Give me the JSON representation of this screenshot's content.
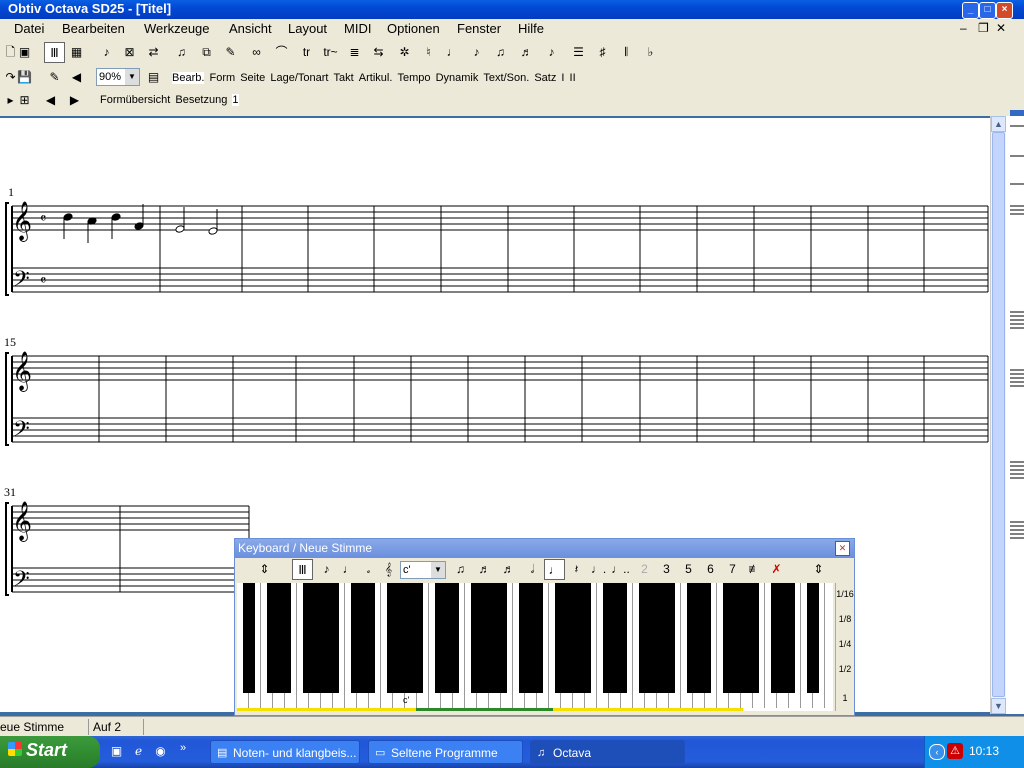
{
  "window": {
    "title": "Obtiv Octava SD25 - [Titel]"
  },
  "menu": [
    "Datei",
    "Bearbeiten",
    "Werkzeuge",
    "Ansicht",
    "Layout",
    "MIDI",
    "Optionen",
    "Fenster",
    "Hilfe"
  ],
  "toolbar": {
    "zoom": "90%",
    "tabs": [
      "Bearb.",
      "Form",
      "Seite",
      "Lage/Tonart",
      "Takt",
      "Artikul.",
      "Tempo",
      "Dynamik",
      "Text/Son.",
      "Satz",
      "I",
      "II"
    ],
    "tabs2": [
      "Formübersicht",
      "Besetzung",
      "1"
    ]
  },
  "score": {
    "system_numbers": [
      "1",
      "15",
      "31"
    ]
  },
  "keyboard": {
    "title": "Keyboard / Neue Stimme",
    "octave_value": "c'",
    "tuplets": [
      "2",
      "3",
      "5",
      "6",
      "7"
    ],
    "middle_c_label": "c'",
    "durations": [
      "1/16",
      "1/8",
      "1/4",
      "1/2",
      "1"
    ]
  },
  "status": {
    "voice": "eue Stimme",
    "mode": "Auf 2"
  },
  "taskbar": {
    "start": "Start",
    "tasks": [
      "Noten- und klangbeis...",
      "Seltene Programme",
      "Octava"
    ],
    "clock": "10:13"
  }
}
